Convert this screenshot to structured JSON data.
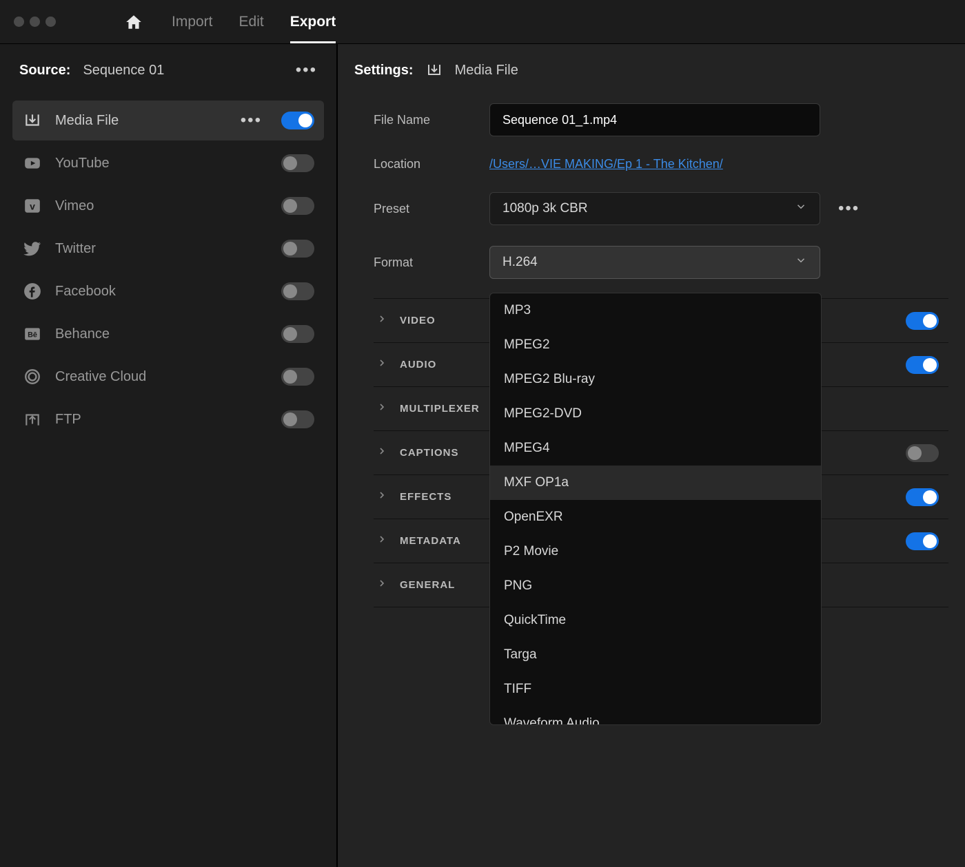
{
  "tabs": {
    "import": "Import",
    "edit": "Edit",
    "export": "Export"
  },
  "source": {
    "label": "Source:",
    "name": "Sequence 01"
  },
  "destinations": [
    {
      "id": "media-file",
      "label": "Media File",
      "icon": "download",
      "selected": true,
      "toggle": true,
      "show_dots": true
    },
    {
      "id": "youtube",
      "label": "YouTube",
      "icon": "youtube",
      "selected": false,
      "toggle": false,
      "show_dots": false
    },
    {
      "id": "vimeo",
      "label": "Vimeo",
      "icon": "vimeo",
      "selected": false,
      "toggle": false,
      "show_dots": false
    },
    {
      "id": "twitter",
      "label": "Twitter",
      "icon": "twitter",
      "selected": false,
      "toggle": false,
      "show_dots": false
    },
    {
      "id": "facebook",
      "label": "Facebook",
      "icon": "facebook",
      "selected": false,
      "toggle": false,
      "show_dots": false
    },
    {
      "id": "behance",
      "label": "Behance",
      "icon": "behance",
      "selected": false,
      "toggle": false,
      "show_dots": false
    },
    {
      "id": "cc",
      "label": "Creative Cloud",
      "icon": "cc",
      "selected": false,
      "toggle": false,
      "show_dots": false
    },
    {
      "id": "ftp",
      "label": "FTP",
      "icon": "upload",
      "selected": false,
      "toggle": false,
      "show_dots": false
    }
  ],
  "settings": {
    "label": "Settings:",
    "title": "Media File",
    "file_name_label": "File Name",
    "file_name": "Sequence 01_1.mp4",
    "location_label": "Location",
    "location": "/Users/…VIE MAKING/Ep 1 - The Kitchen/",
    "preset_label": "Preset",
    "preset": "1080p 3k CBR",
    "format_label": "Format",
    "format": "H.264"
  },
  "format_options": [
    "MP3",
    "MPEG2",
    "MPEG2 Blu-ray",
    "MPEG2-DVD",
    "MPEG4",
    "MXF OP1a",
    "OpenEXR",
    "P2 Movie",
    "PNG",
    "QuickTime",
    "Targa",
    "TIFF",
    "Waveform Audio"
  ],
  "format_hover_index": 5,
  "sections": [
    {
      "id": "video",
      "label": "VIDEO",
      "toggle": true,
      "has_toggle": true
    },
    {
      "id": "audio",
      "label": "AUDIO",
      "toggle": true,
      "has_toggle": true
    },
    {
      "id": "multiplexer",
      "label": "MULTIPLEXER",
      "toggle": null,
      "has_toggle": false
    },
    {
      "id": "captions",
      "label": "CAPTIONS",
      "toggle": false,
      "has_toggle": true
    },
    {
      "id": "effects",
      "label": "EFFECTS",
      "toggle": true,
      "has_toggle": true
    },
    {
      "id": "metadata",
      "label": "METADATA",
      "toggle": true,
      "has_toggle": true
    },
    {
      "id": "general",
      "label": "GENERAL",
      "toggle": null,
      "has_toggle": false
    }
  ]
}
